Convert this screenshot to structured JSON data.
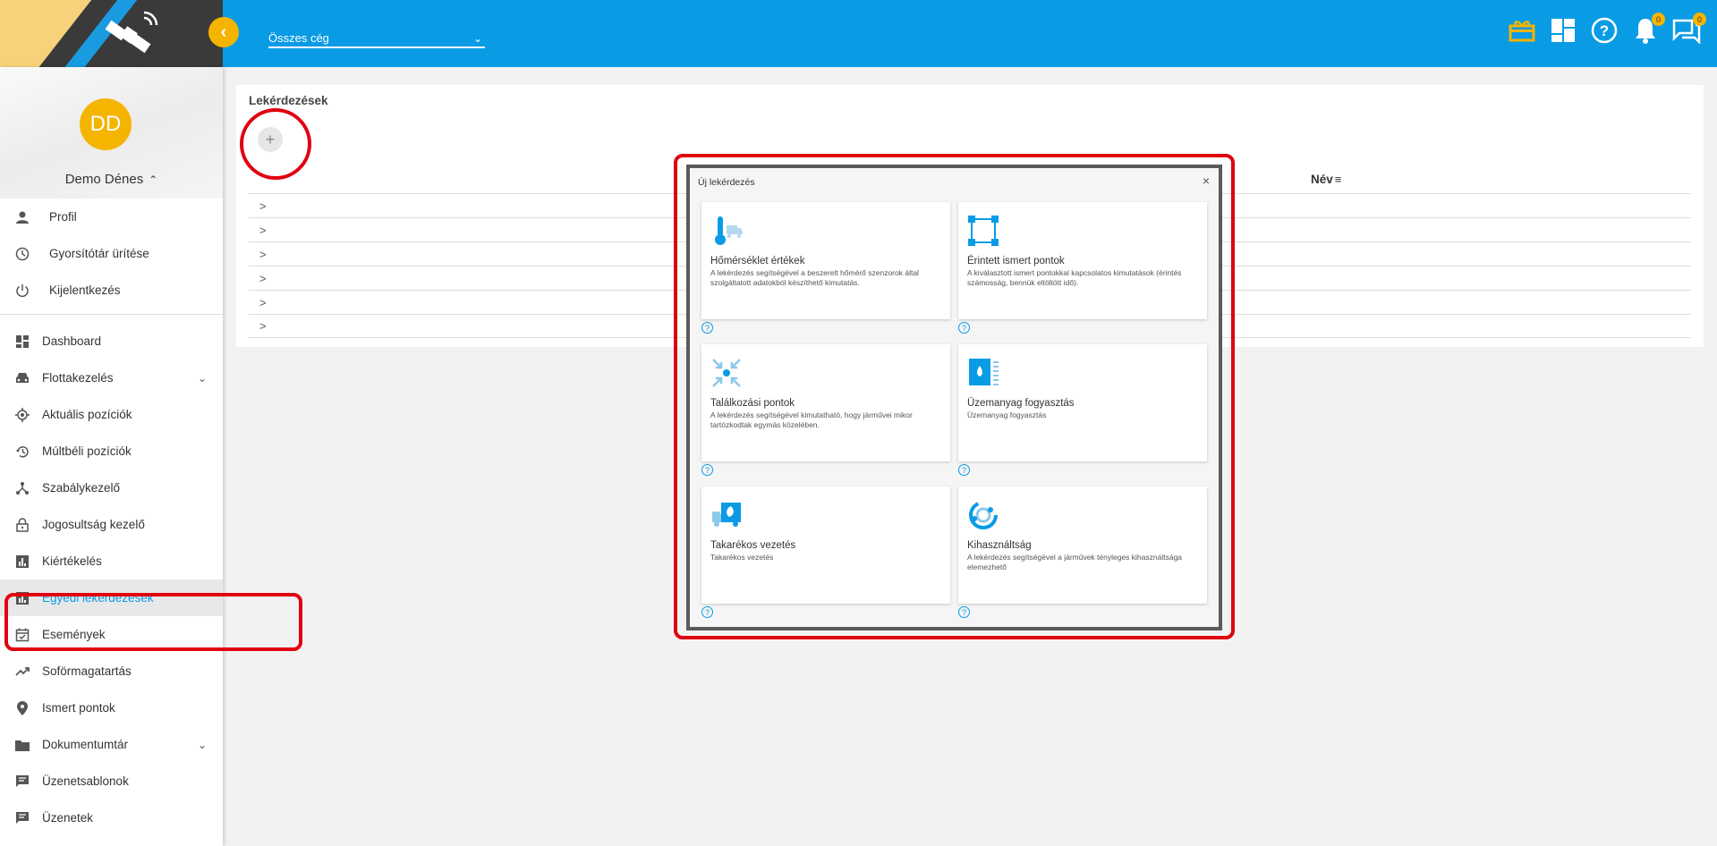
{
  "header": {
    "back_symbol": "‹",
    "company_select": "Összes cég",
    "notifications_count": "0",
    "messages_count": "0"
  },
  "user": {
    "initials": "DD",
    "name": "Demo Dénes"
  },
  "user_menu": [
    {
      "label": "Profil",
      "icon": "person-icon"
    },
    {
      "label": "Gyorsítótár ürítése",
      "icon": "clock-icon"
    },
    {
      "label": "Kijelentkezés",
      "icon": "power-icon"
    }
  ],
  "nav": [
    {
      "label": "Dashboard",
      "icon": "dashboard-icon"
    },
    {
      "label": "Flottakezelés",
      "icon": "car-icon",
      "expandable": true
    },
    {
      "label": "Aktuális pozíciók",
      "icon": "gps-icon"
    },
    {
      "label": "Múltbéli pozíciók",
      "icon": "history-icon"
    },
    {
      "label": "Szabálykezelő",
      "icon": "rules-icon"
    },
    {
      "label": "Jogosultság kezelő",
      "icon": "lock-icon"
    },
    {
      "label": "Kiértékelés",
      "icon": "chart-icon"
    },
    {
      "label": "Egyedi lekérdezések",
      "icon": "chart-icon",
      "active": true
    },
    {
      "label": "Események",
      "icon": "calendar-icon"
    },
    {
      "label": "Soförmagatartás",
      "icon": "trend-icon"
    },
    {
      "label": "Ismert pontok",
      "icon": "pin-icon"
    },
    {
      "label": "Dokumentumtár",
      "icon": "folder-icon",
      "expandable": true
    },
    {
      "label": "Üzenetsablonok",
      "icon": "message-icon"
    },
    {
      "label": "Üzenetek",
      "icon": "message-icon"
    }
  ],
  "main": {
    "title": "Lekérdezések",
    "add_symbol": "+",
    "column_name": "Név",
    "rows": [
      ">",
      ">",
      ">",
      ">",
      ">",
      ">"
    ]
  },
  "dialog": {
    "title": "Új lekérdezés",
    "close_symbol": "×",
    "help_symbol": "?",
    "cards": [
      {
        "title": "Hőmérséklet értékek",
        "desc": "A lekérdezés segítségével a beszerelt hőmérő szenzorok által szolgáltatott adatokból készíthető kimutatás.",
        "icon": "thermometer-icon"
      },
      {
        "title": "Érintett ismert pontok",
        "desc": "A kiválasztott ismert pontokkal kapcsolatos kimutatások (érintés számosság, bennük eltöltött idő).",
        "icon": "waypoints-icon"
      },
      {
        "title": "Találkozási pontok",
        "desc": "A lekérdezés segítségével kimutatható, hogy járművei mikor tartózkodtak egymás közelében.",
        "icon": "meeting-icon"
      },
      {
        "title": "Üzemanyag fogyasztás",
        "desc": "Üzemanyag fogyasztás",
        "icon": "fuel-icon"
      },
      {
        "title": "Takarékos vezetés",
        "desc": "Takarékos vezetés",
        "icon": "eco-truck-icon"
      },
      {
        "title": "Kihasználtság",
        "desc": "A lekérdezés segítségével a járművek tényleges kihasználtsága elemezhető",
        "icon": "utilization-icon"
      }
    ]
  },
  "colors": {
    "primary": "#0a9be5",
    "accent": "#f5b400",
    "highlight": "#e0000f"
  }
}
